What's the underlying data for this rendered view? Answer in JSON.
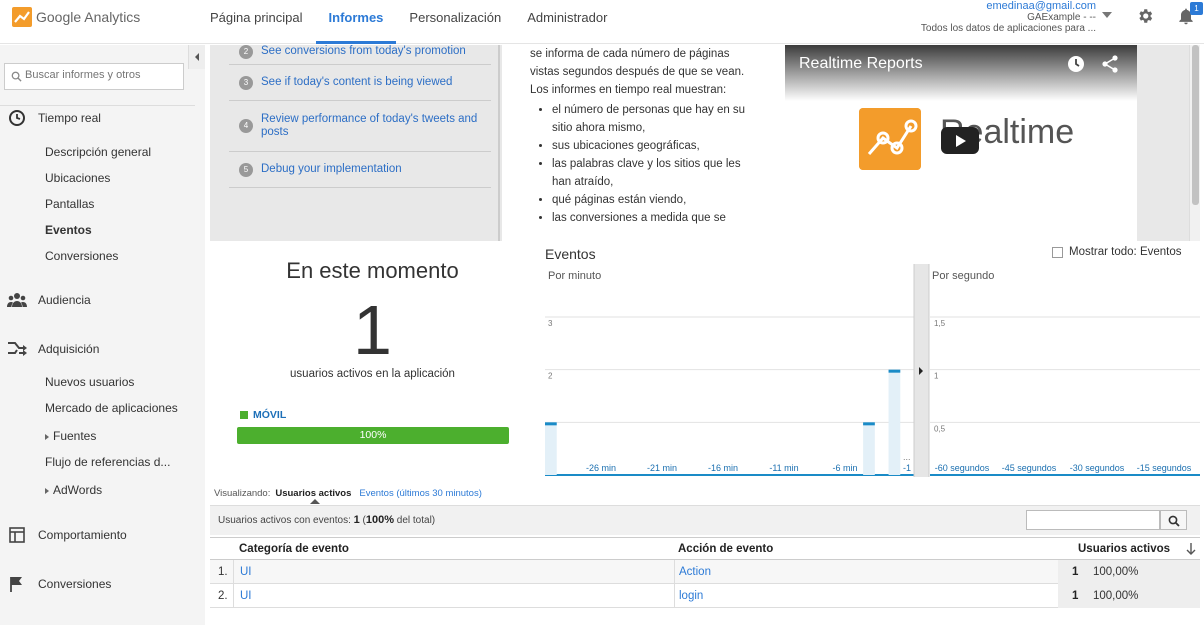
{
  "header": {
    "logo_google": "Google",
    "logo_analytics": "Analytics",
    "nav": [
      "Página principal",
      "Informes",
      "Personalización",
      "Administrador"
    ],
    "active_nav": "Informes",
    "account": {
      "email": "emedinaa@gmail.com",
      "property": "GAExample - --",
      "view": "Todos los datos de aplicaciones para ..."
    },
    "notification_count": "1"
  },
  "sidebar": {
    "search_placeholder": "Buscar informes y otros",
    "sections": {
      "tiempo_real": "Tiempo real",
      "audiencia": "Audiencia",
      "adquisicion": "Adquisición",
      "comportamiento": "Comportamiento",
      "conversiones": "Conversiones"
    },
    "realtime_items": [
      "Descripción general",
      "Ubicaciones",
      "Pantallas",
      "Eventos",
      "Conversiones"
    ],
    "acquisition_items": [
      "Nuevos usuarios",
      "Mercado de aplicaciones",
      "Fuentes",
      "Flujo de referencias d...",
      "AdWords"
    ]
  },
  "intro": {
    "steps": [
      {
        "n": "2",
        "text": "See conversions from today's promotion"
      },
      {
        "n": "3",
        "text": "See if today's content is being viewed"
      },
      {
        "n": "4",
        "text": "Review performance of today's tweets and posts"
      },
      {
        "n": "5",
        "text": "Debug your implementation"
      }
    ],
    "paragraph": "se informa de cada número de páginas vistas segundos después de que se vean. Los informes en tiempo real muestran:",
    "bullets": [
      "el número de personas que hay en su sitio ahora mismo,",
      "sus ubicaciones geográficas,",
      "las palabras clave y los sitios que les han atraído,",
      "qué páginas están viendo,",
      "las conversiones a medida que se"
    ],
    "video": {
      "title": "Realtime Reports",
      "word": "Realtime"
    }
  },
  "right_now": {
    "title": "En este momento",
    "count": "1",
    "subtitle": "usuarios activos en la aplicación",
    "legend": "MÓVIL",
    "bar_label": "100%",
    "bar_fraction": 1.0,
    "colors": {
      "mobile": "#4caf2e"
    }
  },
  "events": {
    "title": "Eventos",
    "show_all_label": "Mostrar todo: Eventos"
  },
  "chart_data": [
    {
      "type": "bar",
      "title": "Por minuto",
      "ylim": [
        0,
        3
      ],
      "yticks": [
        "1",
        "2",
        "3"
      ],
      "xticks": [
        "-26 min",
        "-21 min",
        "-16 min",
        "-11 min",
        "-6 min",
        "-1"
      ],
      "values": [
        1,
        0,
        0,
        0,
        0,
        0,
        0,
        0,
        0,
        0,
        0,
        0,
        0,
        0,
        0,
        0,
        0,
        0,
        0,
        0,
        0,
        0,
        0,
        0,
        0,
        1,
        0,
        2,
        0
      ],
      "overflow_label": "...",
      "color": "#1a8bc7"
    },
    {
      "type": "bar",
      "title": "Por segundo",
      "ylim": [
        0,
        1.5
      ],
      "yticks": [
        "0,5",
        "1",
        "1,5"
      ],
      "xticks": [
        "-60 segundos",
        "-45 segundos",
        "-30 segundos",
        "-15 segundos"
      ],
      "values": [],
      "color": "#1a8bc7"
    }
  ],
  "visualizing": {
    "label": "Visualizando:",
    "current": "Usuarios activos",
    "alternative": "Eventos (últimos 30 minutos)"
  },
  "table": {
    "summary_prefix": "Usuarios activos con eventos:",
    "summary_value": "1",
    "summary_pct": "100%",
    "summary_suffix": "del total)",
    "columns": [
      "Categoría de evento",
      "Acción de evento",
      "Usuarios activos"
    ],
    "rows": [
      {
        "idx": "1.",
        "category": "UI",
        "action": "Action",
        "users": "1",
        "pct": "100,00%"
      },
      {
        "idx": "2.",
        "category": "UI",
        "action": "login",
        "users": "1",
        "pct": "100,00%"
      }
    ]
  }
}
